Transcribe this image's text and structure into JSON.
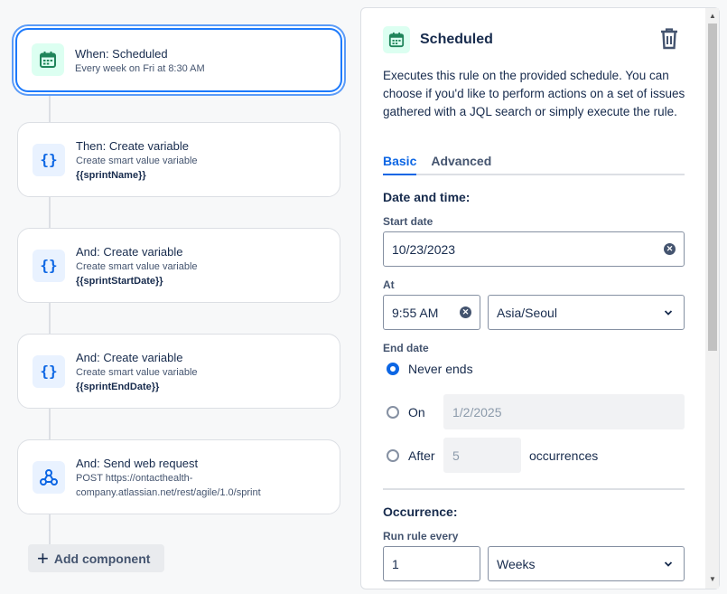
{
  "flow": {
    "items": [
      {
        "title": "When: Scheduled",
        "sub": "Every week on Fri at 8:30 AM",
        "bold": "",
        "icon": "calendar-icon"
      },
      {
        "title": "Then: Create variable",
        "sub": "Create smart value variable",
        "bold": "{{sprintName}}",
        "icon": "curly-braces-icon"
      },
      {
        "title": "And: Create variable",
        "sub": "Create smart value variable",
        "bold": "{{sprintStartDate}}",
        "icon": "curly-braces-icon"
      },
      {
        "title": "And: Create variable",
        "sub": "Create smart value variable",
        "bold": "{{sprintEndDate}}",
        "icon": "curly-braces-icon"
      },
      {
        "title": "And: Send web request",
        "sub": "POST https://ontacthealth-company.atlassian.net/rest/agile/1.0/sprint",
        "bold": "",
        "icon": "webhook-icon"
      }
    ],
    "add_label": "Add component"
  },
  "panel": {
    "title": "Scheduled",
    "description": "Executes this rule on the provided schedule. You can choose if you'd like to perform actions on a set of issues gathered with a JQL search or simply execute the rule.",
    "tabs": [
      {
        "label": "Basic",
        "active": true
      },
      {
        "label": "Advanced",
        "active": false
      }
    ],
    "date_time_heading": "Date and time:",
    "start_date_label": "Start date",
    "start_date_value": "10/23/2023",
    "at_label": "At",
    "time_value": "9:55 AM",
    "timezone_value": "Asia/Seoul",
    "end_date_label": "End date",
    "never_ends_label": "Never ends",
    "on_label": "On",
    "on_date_value": "1/2/2025",
    "after_label": "After",
    "after_value": "5",
    "occurrences_label": "occurrences",
    "occurrence_heading": "Occurrence:",
    "run_every_label": "Run rule every",
    "run_every_value": "1",
    "run_every_unit": "Weeks"
  },
  "colors": {
    "accent": "#0c66e4",
    "selected_border": "#1d7afc",
    "trigger_icon_bg": "#dcfff1",
    "action_icon_bg": "#e9f2ff"
  }
}
